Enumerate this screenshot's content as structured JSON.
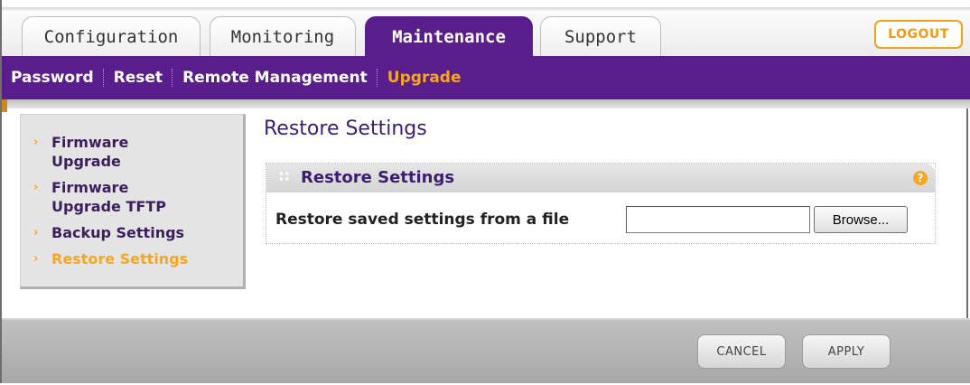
{
  "tabs": [
    {
      "label": "Configuration",
      "active": false
    },
    {
      "label": "Monitoring",
      "active": false
    },
    {
      "label": "Maintenance",
      "active": true
    },
    {
      "label": "Support",
      "active": false
    }
  ],
  "logout_label": "LOGOUT",
  "subnav": {
    "items": [
      "Password",
      "Reset",
      "Remote Management",
      "Upgrade"
    ],
    "current": "Upgrade"
  },
  "sidebar": {
    "items": [
      {
        "label_line1": "Firmware",
        "label_line2": "Upgrade"
      },
      {
        "label_line1": "Firmware",
        "label_line2": "Upgrade TFTP"
      },
      {
        "label_line1": "Backup Settings",
        "label_line2": ""
      },
      {
        "label_line1": "Restore Settings",
        "label_line2": ""
      }
    ],
    "current": "Restore Settings"
  },
  "main": {
    "page_title": "Restore Settings",
    "panel_title": "Restore Settings",
    "help_icon": "?",
    "field_label": "Restore saved settings from a file",
    "file_value": "",
    "browse_label": "Browse..."
  },
  "footer": {
    "cancel_label": "CANCEL",
    "apply_label": "APPLY"
  },
  "colors": {
    "brand_purple": "#5a1e8c",
    "accent_orange": "#f5a623"
  }
}
